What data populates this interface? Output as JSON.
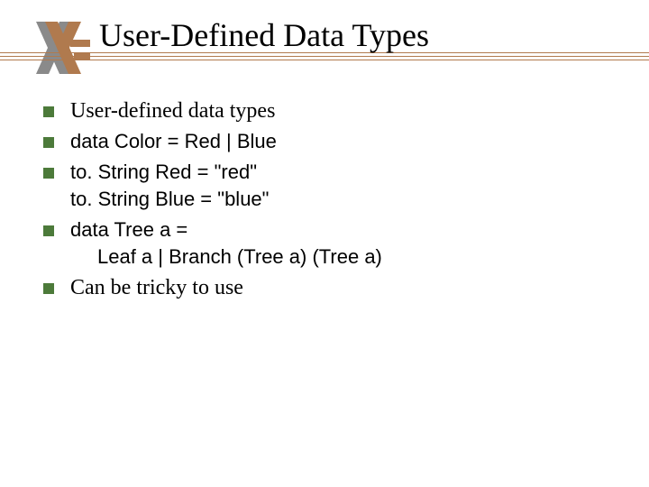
{
  "slide": {
    "title": "User-Defined Data Types",
    "bullets": [
      {
        "lines": [
          "User-defined data types"
        ],
        "font": "serif"
      },
      {
        "lines": [
          "data Color = Red | Blue"
        ],
        "font": "sans"
      },
      {
        "lines": [
          "to. String Red    = \"red\"",
          "to. String Blue   = \"blue\""
        ],
        "font": "sans"
      },
      {
        "lines": [
          "data Tree a =",
          "  Leaf a | Branch (Tree a) (Tree a)"
        ],
        "font": "sans",
        "indentAfterFirst": true
      },
      {
        "lines": [
          "Can be tricky to use"
        ],
        "font": "serif"
      }
    ]
  }
}
